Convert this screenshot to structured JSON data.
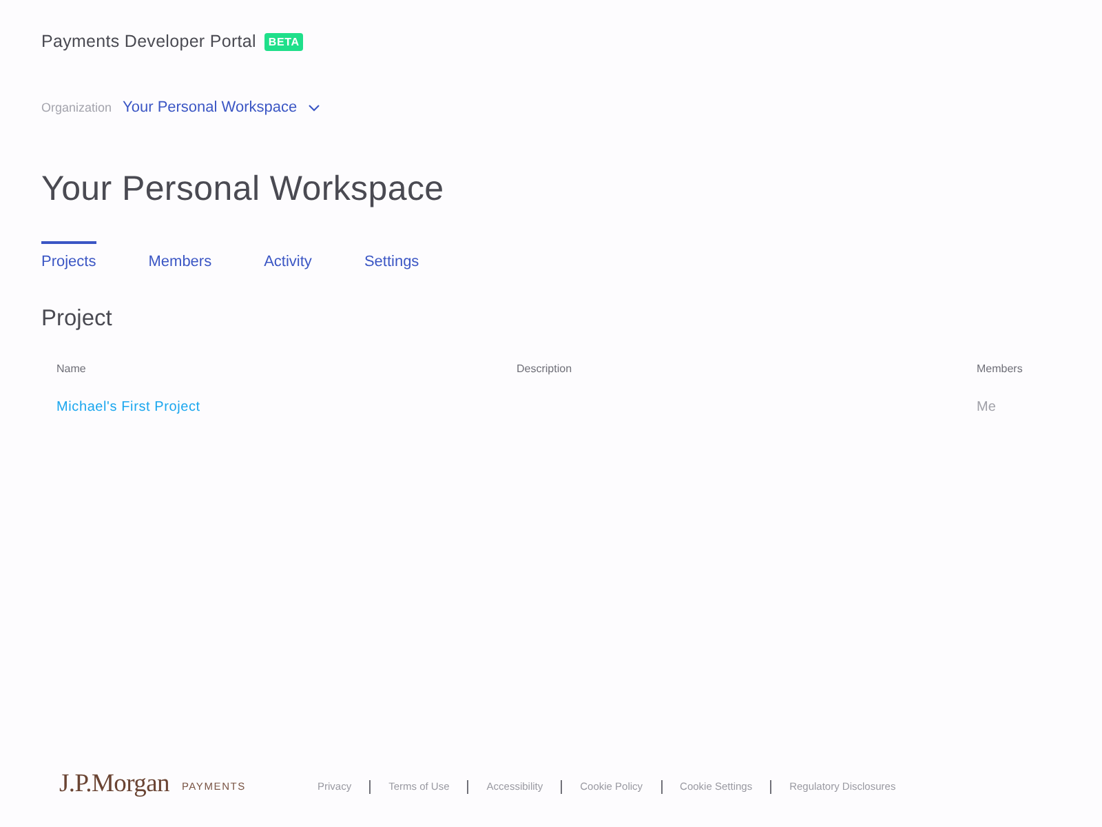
{
  "header": {
    "title": "Payments Developer Portal",
    "badge": "BETA"
  },
  "organization": {
    "label": "Organization",
    "value": "Your Personal Workspace"
  },
  "page_title": "Your Personal Workspace",
  "tabs": [
    {
      "label": "Projects",
      "selected": true
    },
    {
      "label": "Members",
      "selected": false
    },
    {
      "label": "Activity",
      "selected": false
    },
    {
      "label": "Settings",
      "selected": false
    }
  ],
  "section_title": "Project",
  "table": {
    "columns": [
      "Name",
      "Description",
      "Members"
    ],
    "rows": [
      {
        "name": "Michael's First Project",
        "members": "Me"
      }
    ]
  },
  "footer": {
    "logo": "J.P.Morgan",
    "logo_sub": "PAYMENTS",
    "links": [
      "Privacy",
      "Terms of Use",
      "Accessibility",
      "Cookie Policy",
      "Cookie Settings",
      "Regulatory Disclosures"
    ]
  }
}
